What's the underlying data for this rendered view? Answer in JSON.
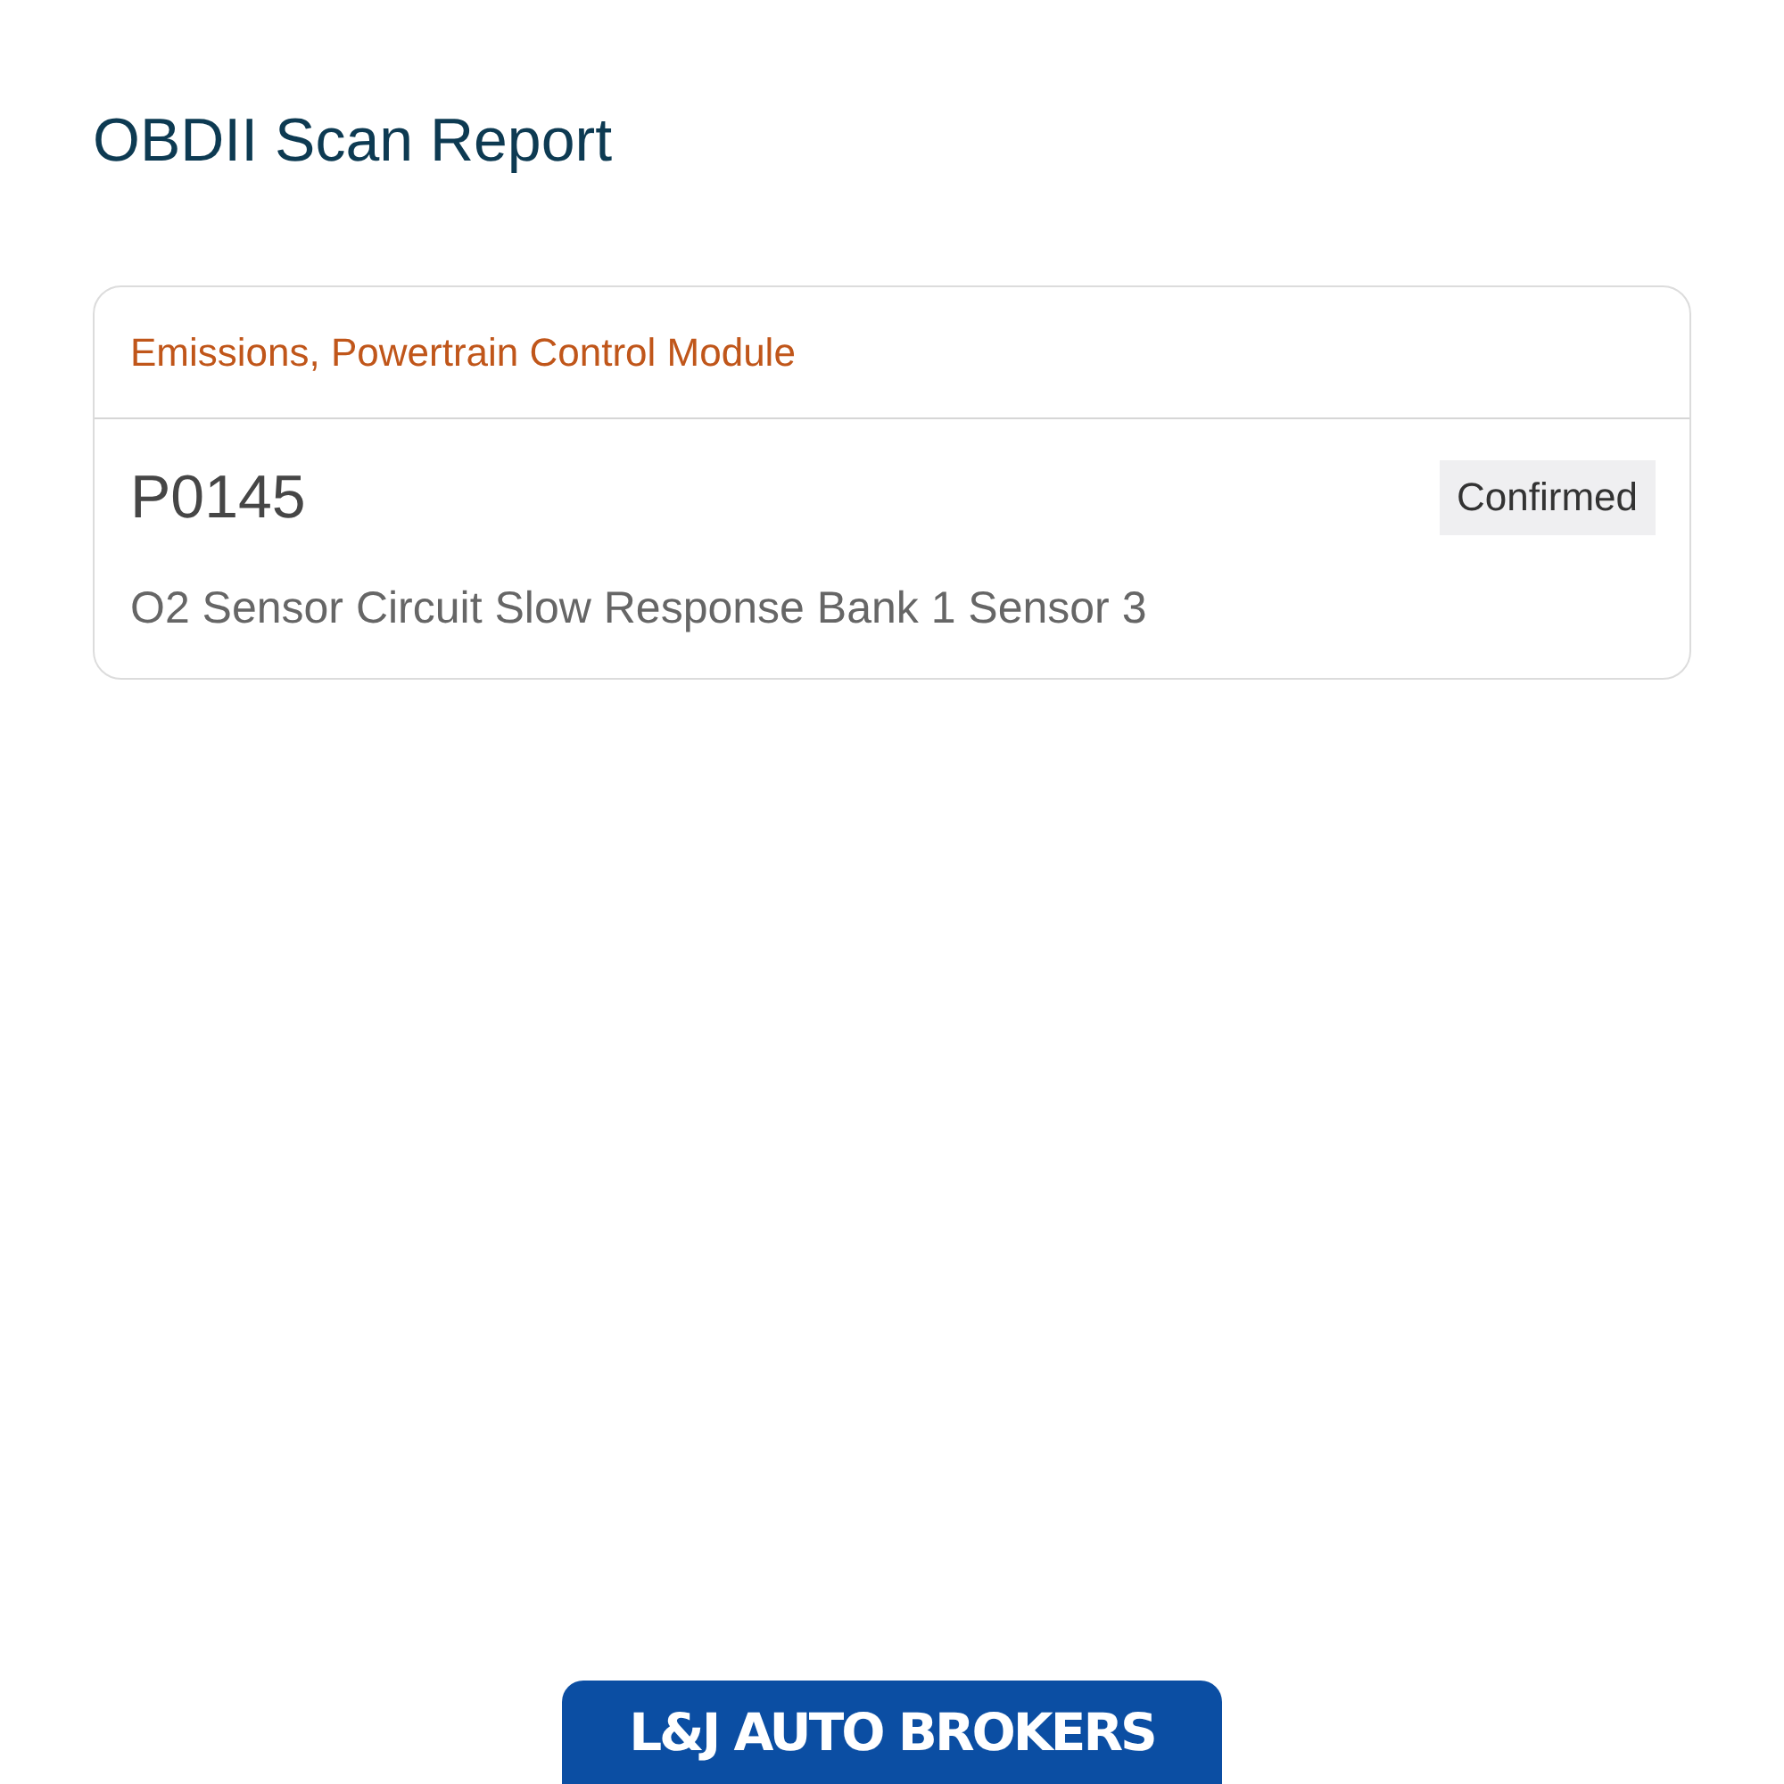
{
  "page": {
    "title": "OBDII Scan Report"
  },
  "modules": [
    {
      "name": "Emissions, Powertrain Control Module",
      "codes": [
        {
          "code": "P0145",
          "status": "Confirmed",
          "description": "O2 Sensor Circuit Slow Response Bank 1 Sensor 3"
        }
      ]
    }
  ],
  "footer": {
    "logo_text": "L&J AUTO BROKERS"
  }
}
